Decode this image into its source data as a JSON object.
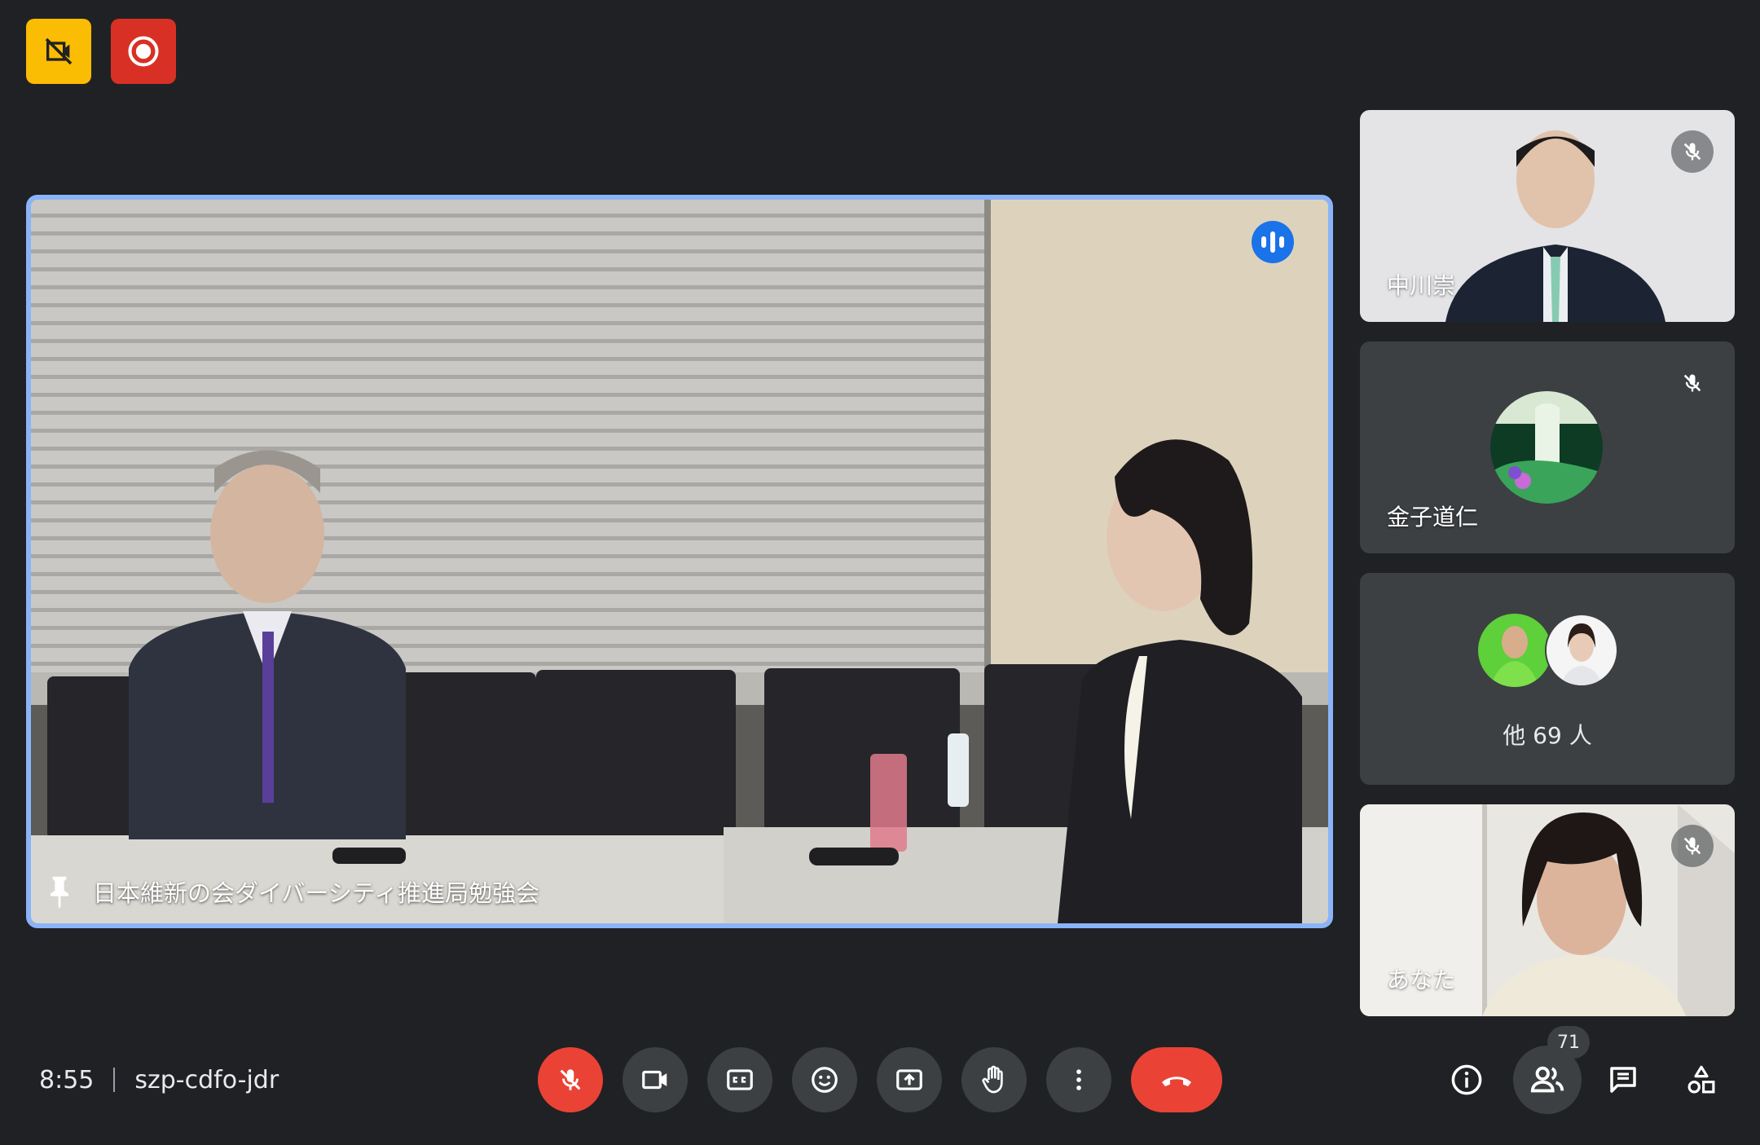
{
  "top_indicators": [
    {
      "icon": "camera-off-icon",
      "color": "#fbbc04"
    },
    {
      "icon": "recording-icon",
      "color": "#d93025"
    }
  ],
  "main_stage": {
    "label": "日本維新の会ダイバーシティ推進局勉強会",
    "pinned": true,
    "speaking": true,
    "highlight_color": "#8ab4f8"
  },
  "participants": [
    {
      "name": "中川崇",
      "muted": true,
      "kind": "video"
    },
    {
      "name": "金子道仁",
      "muted": true,
      "kind": "avatar"
    },
    {
      "name": "他 69 人",
      "kind": "group"
    },
    {
      "name": "あなた",
      "muted": true,
      "kind": "self-video"
    }
  ],
  "meeting": {
    "time": "8:55",
    "code": "szp-cdfo-jdr"
  },
  "controls": [
    {
      "name": "microphone-off",
      "icon": "mic-off-icon",
      "active_color": "#ea4335"
    },
    {
      "name": "camera",
      "icon": "videocam-icon"
    },
    {
      "name": "captions",
      "icon": "closed-caption-icon"
    },
    {
      "name": "reactions",
      "icon": "emoji-icon"
    },
    {
      "name": "present",
      "icon": "present-screen-icon"
    },
    {
      "name": "raise-hand",
      "icon": "hand-icon"
    },
    {
      "name": "more-options",
      "icon": "more-vert-icon"
    },
    {
      "name": "leave-call",
      "icon": "call-end-icon",
      "active_color": "#ea4335"
    }
  ],
  "right_controls": {
    "participant_count": "71",
    "items": [
      "info-icon",
      "people-icon",
      "chat-icon",
      "activities-icon"
    ]
  }
}
